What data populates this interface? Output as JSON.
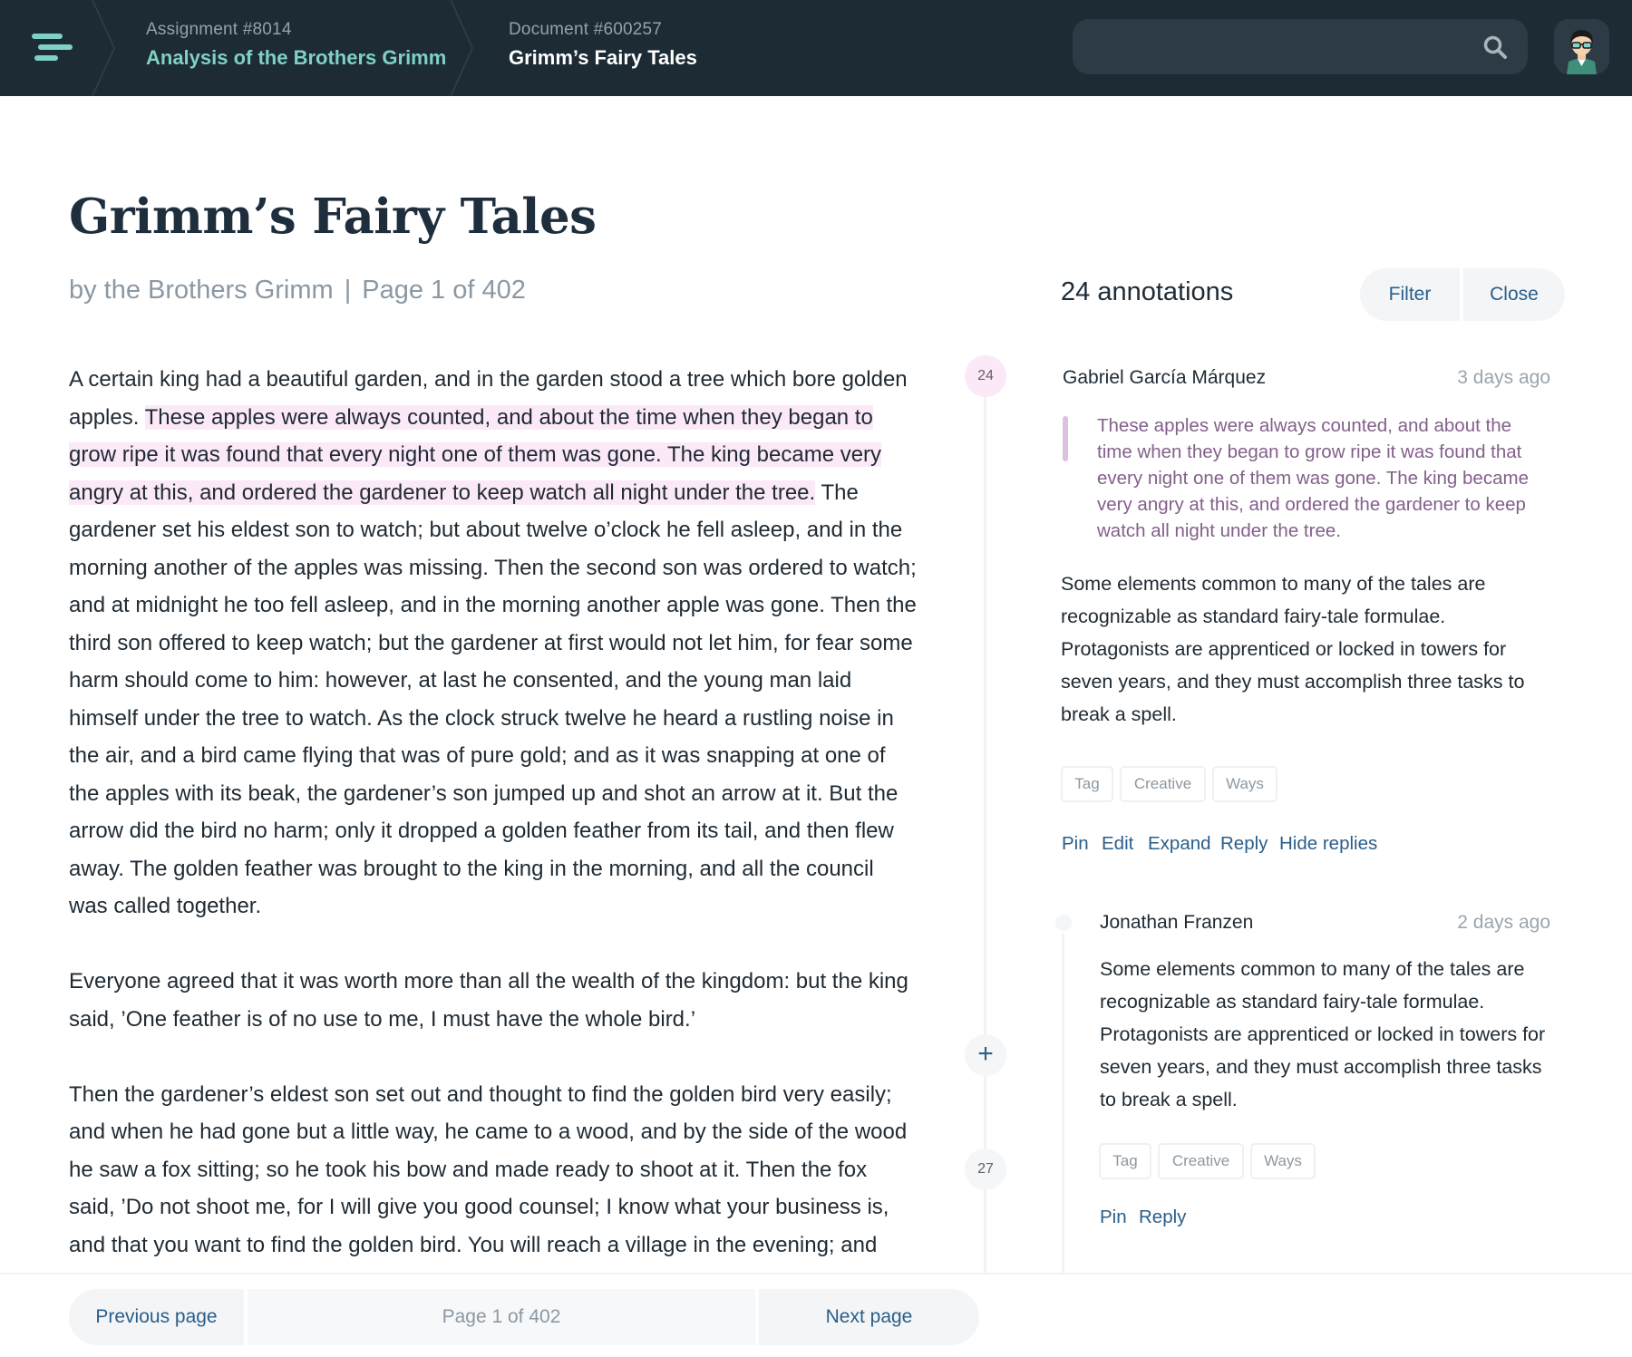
{
  "header": {
    "breadcrumb": [
      {
        "label": "Assignment #8014",
        "title": "Analysis of the Brothers Grimm"
      },
      {
        "label": "Document #600257",
        "title": "Grimm’s Fairy Tales"
      }
    ],
    "search": {
      "value": "",
      "placeholder": ""
    }
  },
  "document": {
    "title": "Grimm’s Fairy Tales",
    "author": "by the Brothers Grimm",
    "separator": "|",
    "page": "Page 1 of 402",
    "paragraphs": [
      {
        "before": "A certain king had a beautiful garden, and in the garden stood a tree which bore golden apples. ",
        "highlight": "These apples were always counted, and about the time when they began to grow ripe it was found that every night one of them was gone. The king became very angry at this, and ordered the gardener to keep watch all night under the tree.",
        "after": " The gardener set his eldest son to watch; but about twelve o’clock he fell asleep, and in the morning another of the apples was missing. Then the second son was ordered to watch; and at midnight he too fell asleep, and in the morning another apple was gone. Then the third son offered to keep watch; but the gardener at first would not let him, for fear some harm should come to him: however, at last he consented, and the young man laid himself under the tree to watch. As the clock struck twelve he heard a rustling noise in the air, and a bird came flying that was of pure gold; and as it was snapping at one of the apples with its beak, the gardener’s son jumped up and shot an arrow at it. But the arrow did the bird no harm; only it dropped a golden feather from its tail, and then flew away. The golden feather was brought to the king in the morning, and all the council was called together."
      },
      {
        "text": "Everyone agreed that it was worth more than all the wealth of the kingdom: but the king said, ’One feather is of no use to me, I must have the whole bird.’"
      },
      {
        "text": "Then the gardener’s eldest son set out and thought to find the golden bird very easily; and when he had gone but a little way, he came to a wood, and by the side of the wood he saw a fox sitting; so he took his bow and made ready to shoot at it. Then the fox said, ’Do not shoot me, for I will give you good counsel; I know what your business is, and that you want to find the golden bird. You will reach a village in the evening; and"
      }
    ]
  },
  "timeline": {
    "markers": [
      "24",
      "27"
    ],
    "add_icon": "+"
  },
  "annotations": {
    "count_label": "24 annotations",
    "filter_label": "Filter",
    "close_label": "Close",
    "items": [
      {
        "author": "Gabriel García Márquez",
        "time": "3 days ago",
        "quote": "These apples were always counted, and about the time when they began to grow ripe it was found that every night one of them was gone. The king became very angry at this, and ordered the gardener to keep watch all night under the tree.",
        "text": "Some elements common to many of the tales are recognizable as standard fairy-tale formulae. Protagonists are apprenticed or locked in towers for seven years, and they must accomplish three tasks to break a spell.",
        "tags": [
          "Tag",
          "Creative",
          "Ways"
        ],
        "actions": [
          "Pin",
          "Edit",
          "Expand",
          "Reply",
          "Hide replies"
        ]
      },
      {
        "author": "Jonathan Franzen",
        "time": "2 days ago",
        "text": "Some elements common to many of the tales are recognizable as standard fairy-tale formulae. Protagonists are apprenticed or locked in towers for seven years, and they must accomplish three tasks to break a spell.",
        "tags": [
          "Tag",
          "Creative",
          "Ways"
        ],
        "actions": [
          "Pin",
          "Reply"
        ]
      }
    ]
  },
  "footer": {
    "prev_label": "Previous page",
    "status": "Page 1 of 402",
    "next_label": "Next page"
  },
  "colors": {
    "topbar": "#1d2b35",
    "accent_teal": "#7fd0c6",
    "link_blue": "#2a5e8a",
    "highlight_pink": "#fbe9f8",
    "quote_purple": "#83608a"
  },
  "icons": {
    "menu": "hamburger-menu-icon",
    "search": "search-icon",
    "avatar": "user-avatar",
    "add": "plus-icon"
  }
}
